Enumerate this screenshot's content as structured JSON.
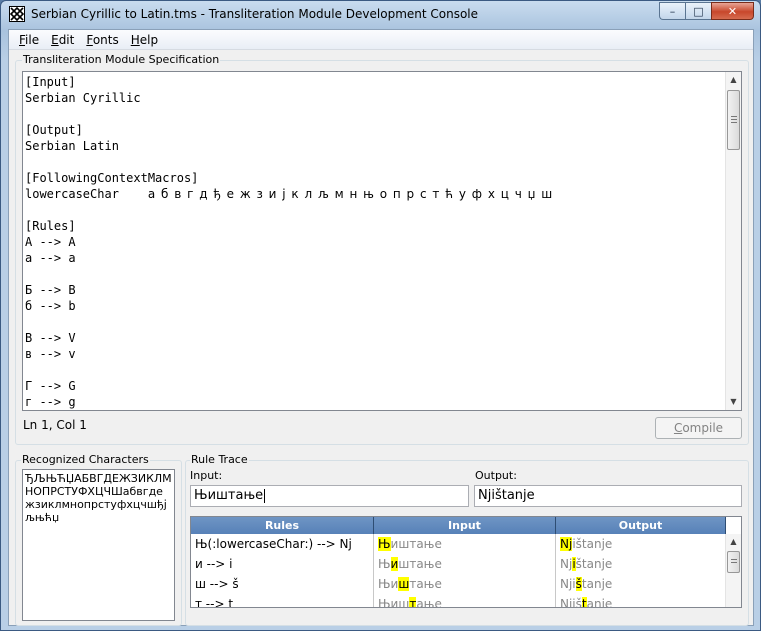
{
  "window": {
    "title": "Serbian Cyrillic to Latin.tms - Transliteration Module Development Console",
    "controls": {
      "minimize": "–",
      "maximize": "□",
      "close": "✕"
    }
  },
  "menu": [
    {
      "accel": "F",
      "rest": "ile"
    },
    {
      "accel": "E",
      "rest": "dit"
    },
    {
      "accel": "F",
      "rest": "onts"
    },
    {
      "accel": "H",
      "rest": "elp"
    }
  ],
  "spec": {
    "group_label": "Transliteration Module Specification",
    "lines": [
      "[Input]",
      "Serbian Cyrillic",
      "",
      "[Output]",
      "Serbian Latin",
      "",
      "[FollowingContextMacros]",
      "",
      "",
      "[Rules]",
      "А --> A",
      "а --> a",
      "",
      "Б --> B",
      "б --> b",
      "",
      "В --> V",
      "в --> v",
      "",
      "Г --> G",
      "г --> g"
    ],
    "macro_name": "lowercaseChar",
    "macro_chars": "а б в г д ђ е ж з и ј к л љ м н њ о п р с т ћ у ф х ц ч џ ш"
  },
  "status": {
    "position": "Ln 1, Col 1"
  },
  "compile_button": {
    "accel": "C",
    "rest": "ompile"
  },
  "recognized": {
    "group_label": "Recognized Characters",
    "text": "ЂЉЊЋЏАБВГДЕЖЗИКЛМНОПРСТУФХЦЧШабвгдежзиклмнопрстуфхцчшђјљњћџ"
  },
  "trace": {
    "group_label": "Rule Trace",
    "input_label": "Input:",
    "output_label": "Output:",
    "input_value": "Њиштање",
    "output_value": "Njištanje",
    "columns": [
      "Rules",
      "Input",
      "Output"
    ],
    "rows": [
      {
        "rule": "Њ(:lowercaseChar:) --> Nj",
        "in_pre": "",
        "in_hl": "Њ",
        "in_post": "иштање",
        "out_pre": "",
        "out_hl": "Nj",
        "out_post": "ištanje"
      },
      {
        "rule": "и --> i",
        "in_pre": "Њ",
        "in_hl": "и",
        "in_post": "штање",
        "out_pre": "Nj",
        "out_hl": "i",
        "out_post": "štanje"
      },
      {
        "rule": "ш --> š",
        "in_pre": "Њи",
        "in_hl": "ш",
        "in_post": "тање",
        "out_pre": "Nji",
        "out_hl": "š",
        "out_post": "tanje"
      },
      {
        "rule": "т --> t",
        "in_pre": "Њиш",
        "in_hl": "т",
        "in_post": "ање",
        "out_pre": "Njiš",
        "out_hl": "t",
        "out_post": "anje"
      }
    ]
  }
}
